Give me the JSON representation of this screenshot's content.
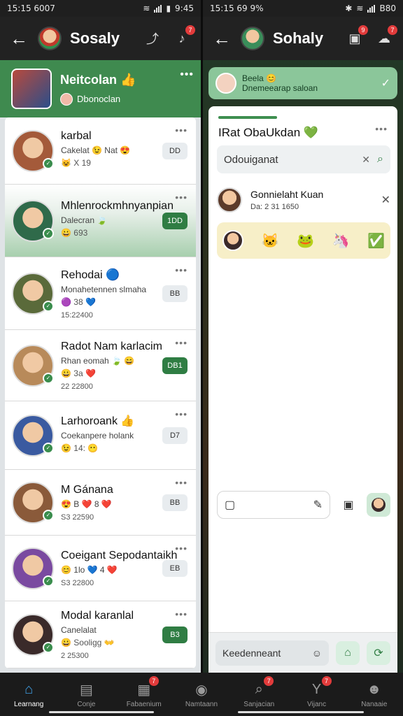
{
  "left": {
    "status": {
      "time": "15:15 6007",
      "right_time": "9:45"
    },
    "appbar": {
      "title": "Sosaly",
      "badge": "7"
    },
    "pinned": {
      "name": "Neitcolan",
      "sub": "Dbonoclan",
      "emoji": "👍"
    },
    "chats": [
      {
        "name": "karbal",
        "msg": "Cakelat 😉 Nat 😍",
        "meta": "😺 X 19",
        "time": "",
        "pill": "DD",
        "pill_green": false,
        "avatar": "#a45a3a"
      },
      {
        "name": "Mhlenrockmhnyanpian",
        "msg": "Dalecran 🍃",
        "meta": "😀 693",
        "time": "",
        "pill": "1DD",
        "pill_green": true,
        "avatar": "#2f6a4a",
        "selected": true
      },
      {
        "name": "Rehodai 🔵",
        "msg": "Monahetennen slmaha",
        "meta": "🟣 38 💙",
        "time": "15:22400",
        "pill": "BB",
        "pill_green": false,
        "avatar": "#5a6a3a"
      },
      {
        "name": "Radot Nam karlacim",
        "msg": "Rhan eomah 🍃 😄",
        "meta": "😀 3a ❤️",
        "time": "22 22800",
        "pill": "DB1",
        "pill_green": true,
        "avatar": "#b88a5a"
      },
      {
        "name": "Larhoroank 👍",
        "msg": "Coekanpere holank",
        "meta": "😉 14: 😶",
        "time": "",
        "pill": "D7",
        "pill_green": false,
        "avatar": "#3a5aa0"
      },
      {
        "name": "M Gánana",
        "msg": "😍 B ❤️ 8 ❤️",
        "meta": "",
        "time": "S3 22590",
        "pill": "BB",
        "pill_green": false,
        "avatar": "#8a5a3a"
      },
      {
        "name": "Coeigant Sepodantaikh",
        "msg": "😊 1lo 💙 4 ❤️",
        "meta": "",
        "time": "S3 22800",
        "pill": "EB",
        "pill_green": false,
        "avatar": "#7a4aa0"
      },
      {
        "name": "Modal karanlal",
        "msg": "Canelalat",
        "meta": "😀 Sooligg 👐",
        "time": "2 25300",
        "pill": "B3",
        "pill_green": true,
        "avatar": "#3a2a2a"
      }
    ]
  },
  "right": {
    "status": {
      "time": "15:15 69 9%",
      "right_time": "B80"
    },
    "appbar": {
      "title": "Sohaly",
      "badge1": "9",
      "badge2": "7"
    },
    "notice": {
      "line1": "Beela 😊",
      "line2": "Dnemeearap saloan"
    },
    "panel": {
      "title": "IRat ObaUkdan 💚",
      "search_value": "Odouiganat",
      "contact_name": "Gonnielaht Kuan",
      "contact_sub": "Da: 2 31 1650",
      "stickers": [
        "🐱",
        "🐸",
        "🦄",
        "✅"
      ],
      "compose_placeholder": "",
      "bottom_input": "Keedenneant"
    }
  },
  "nav": [
    {
      "label": "Learnang",
      "icon": "⌂",
      "active": true,
      "badge": ""
    },
    {
      "label": "Conje",
      "icon": "▤",
      "active": false,
      "badge": ""
    },
    {
      "label": "Fabaenium",
      "icon": "▦",
      "active": false,
      "badge": "7"
    },
    {
      "label": "Namtaann",
      "icon": "◉",
      "active": false,
      "badge": ""
    },
    {
      "label": "Sanjacian",
      "icon": "⌕",
      "active": false,
      "badge": "7"
    },
    {
      "label": "Vijanc",
      "icon": "Y",
      "active": false,
      "badge": "7"
    },
    {
      "label": "Nanaaie",
      "icon": "☻",
      "active": false,
      "badge": ""
    }
  ]
}
